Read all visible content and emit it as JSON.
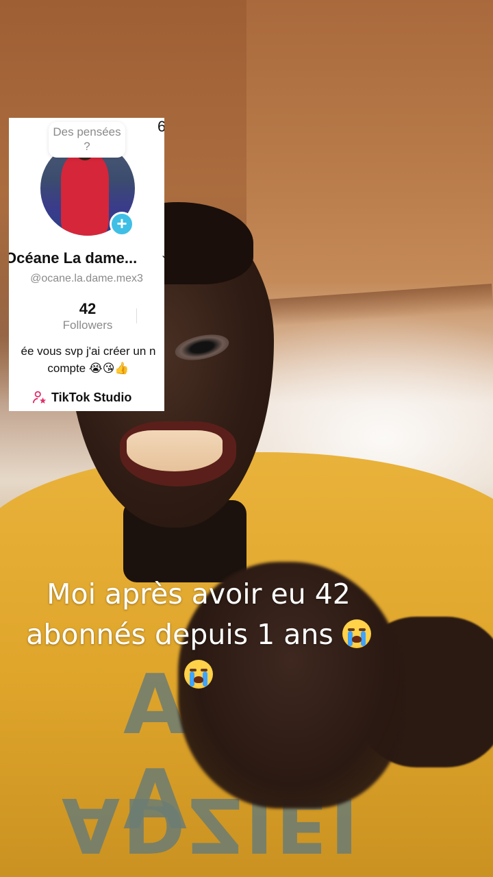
{
  "profile_card": {
    "thought_bubble": "Des pensées ?",
    "display_name": "Océane La dame...",
    "name_chevron": "⌄",
    "edge_glyph": "6",
    "username": "@ocane.la.dame.mex3",
    "followers_count": "42",
    "followers_label": "Followers",
    "bio_line1": "ée vous svp j'ai créer un n",
    "bio_line2": "compte 😭😘👍",
    "studio_label": "TikTok Studio",
    "add_icon": "plus-icon",
    "studio_icon": "person-star-icon",
    "accent_color": "#3fbfe6"
  },
  "caption": {
    "line1": "Moi après avoir eu 42",
    "line2": "abonnés depuis 1 ans",
    "emoji_icon": "loudly-crying-face-icon"
  },
  "shirt_print": {
    "upper": "A A",
    "lower": "ADZIEI"
  }
}
